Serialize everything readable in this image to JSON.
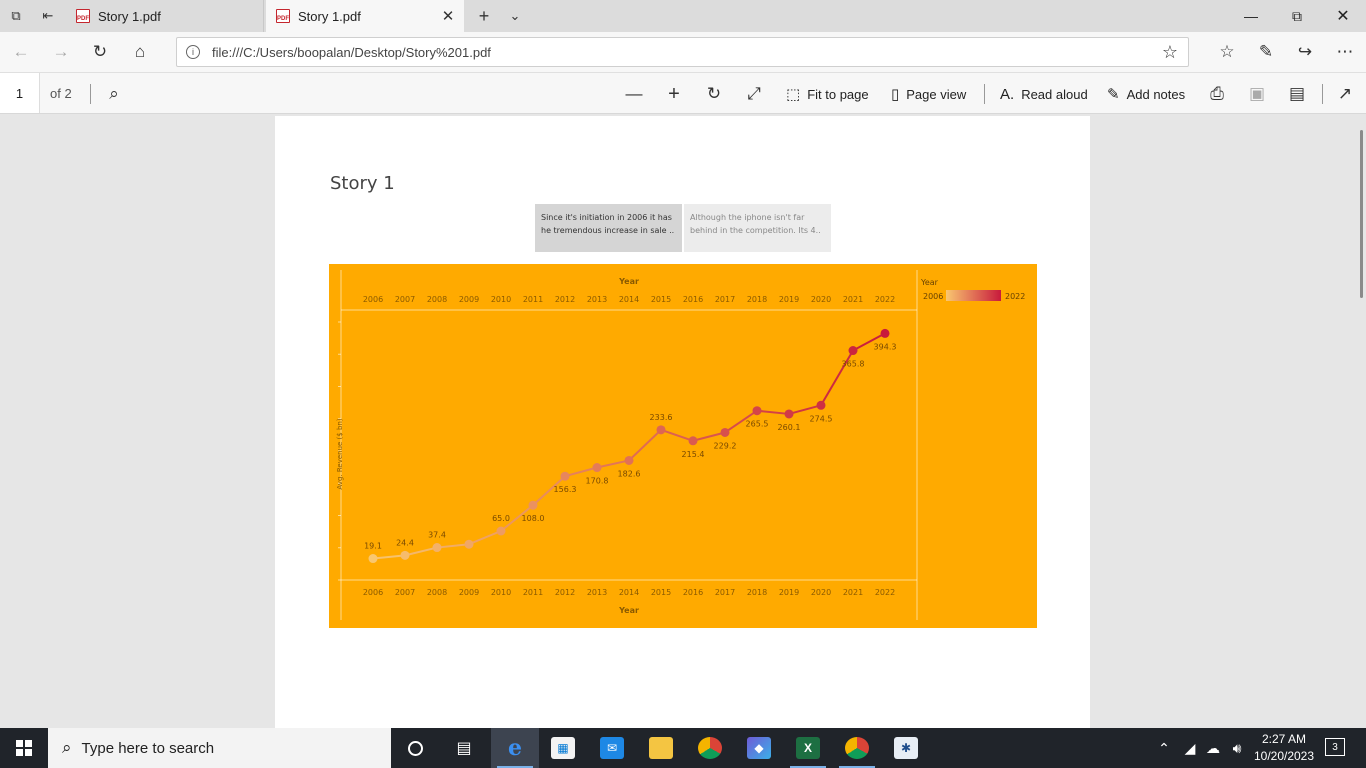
{
  "browser": {
    "tabs": [
      {
        "title": "Story 1.pdf",
        "active": false
      },
      {
        "title": "Story 1.pdf",
        "active": true
      }
    ],
    "url": "file:///C:/Users/boopalan/Desktop/Story%201.pdf"
  },
  "pdf_toolbar": {
    "page_current": "1",
    "page_total": "of 2",
    "fit_to_page": "Fit to page",
    "page_view": "Page view",
    "read_aloud": "Read aloud",
    "add_notes": "Add notes"
  },
  "document": {
    "story_title": "Story 1",
    "story_points": [
      "Since it's initiation in 2006 it has he tremendous increase in sale ..",
      "Although the iphone isn't far behind in the competition. Its 4.."
    ]
  },
  "chart_data": {
    "type": "line",
    "background": "#ffaa00",
    "x_axis_label": "Year",
    "y_axis_label": "Avg. Revenue ($ bn)",
    "x": [
      "2006",
      "2007",
      "2008",
      "2009",
      "2010",
      "2011",
      "2012",
      "2013",
      "2014",
      "2015",
      "2016",
      "2017",
      "2018",
      "2019",
      "2020",
      "2021",
      "2022"
    ],
    "values": [
      19.1,
      24.4,
      37.4,
      43.0,
      65.0,
      108.0,
      156.3,
      170.8,
      182.6,
      233.6,
      215.4,
      229.2,
      265.5,
      260.1,
      274.5,
      365.8,
      394.3
    ],
    "labels": [
      "19.1",
      "24.4",
      "37.4",
      "",
      "65.0",
      "108.0",
      "156.3",
      "170.8",
      "182.6",
      "233.6",
      "215.4",
      "229.2",
      "265.5",
      "260.1",
      "274.5",
      "365.8",
      "394.3"
    ],
    "ylim": [
      0,
      400
    ],
    "legend": {
      "title": "Year",
      "min_label": "2006",
      "max_label": "2022",
      "color_low": "#f9c770",
      "color_high": "#c81a3c"
    }
  },
  "taskbar": {
    "search_placeholder": "Type here to search",
    "time": "2:27 AM",
    "date": "10/20/2023",
    "notifications": "3"
  }
}
